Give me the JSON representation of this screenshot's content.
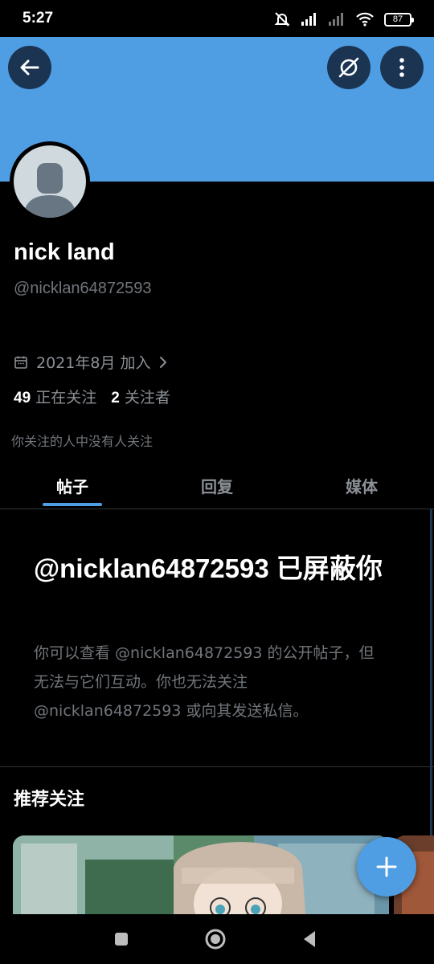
{
  "status_bar": {
    "time": "5:27",
    "battery": "87"
  },
  "profile": {
    "display_name": "nick land",
    "handle": "@nicklan64872593",
    "joined": "2021年8月 加入",
    "following_count": "49",
    "following_label": "正在关注",
    "followers_count": "2",
    "followers_label": "关注者",
    "followers_note": "你关注的人中没有人关注"
  },
  "tabs": [
    {
      "label": "帖子",
      "active": true
    },
    {
      "label": "回复",
      "active": false
    },
    {
      "label": "媒体",
      "active": false
    }
  ],
  "blocked": {
    "title": "@nicklan64872593 已屏蔽你",
    "description": "你可以查看 @nicklan64872593 的公开帖子，但无法与它们互动。你也无法关注 @nicklan64872593 或向其发送私信。"
  },
  "recommendations": {
    "title": "推荐关注"
  },
  "icons": {
    "back": "arrow-left-icon",
    "grok": "grok-icon",
    "more": "more-vertical-icon",
    "calendar": "calendar-icon",
    "chevron": "chevron-right-icon",
    "compose": "plus-icon"
  },
  "colors": {
    "accent": "#4f9de3",
    "background": "#000000",
    "muted_text": "#71767b"
  }
}
